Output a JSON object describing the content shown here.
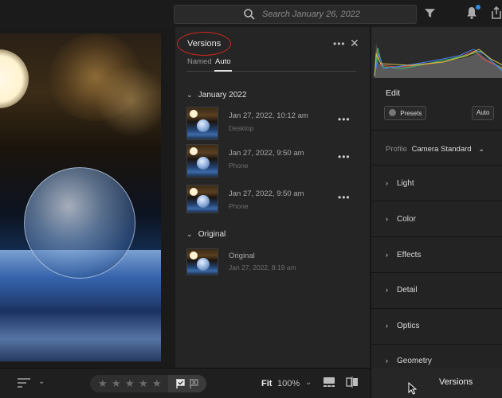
{
  "topbar": {
    "search_placeholder": "Search January 26, 2022",
    "icons": [
      "search-icon",
      "filter-icon",
      "bell-icon",
      "share-icon"
    ],
    "notification_color": "#2c8ce6"
  },
  "versions_panel": {
    "title": "Versions",
    "more": "•••",
    "close": "✕",
    "tabs": [
      {
        "label": "Named",
        "active": false
      },
      {
        "label": "Auto",
        "active": true
      }
    ],
    "groups": [
      {
        "label": "January 2022",
        "items": [
          {
            "date": "Jan 27, 2022, 10:12 am",
            "device": "Desktop",
            "more": "•••"
          },
          {
            "date": "Jan 27, 2022, 9:50 am",
            "device": "Phone",
            "more": "•••"
          },
          {
            "date": "Jan 27, 2022, 9:50 am",
            "device": "Phone",
            "more": "•••"
          }
        ]
      },
      {
        "label": "Original",
        "items": [
          {
            "date": "Original",
            "device": "Jan 27, 2022, 8:19 am"
          }
        ]
      }
    ],
    "highlight_color": "#d0281f"
  },
  "edit_panel": {
    "title": "Edit",
    "presets_label": "Presets",
    "auto_label": "Auto",
    "profile_label": "Profile",
    "profile_value": "Camera Standard",
    "sections": [
      "Light",
      "Color",
      "Effects",
      "Detail",
      "Optics",
      "Geometry"
    ]
  },
  "bottombar": {
    "fit_label": "Fit",
    "zoom_value": "100%",
    "stars": 5,
    "versions_label": "Versions"
  }
}
